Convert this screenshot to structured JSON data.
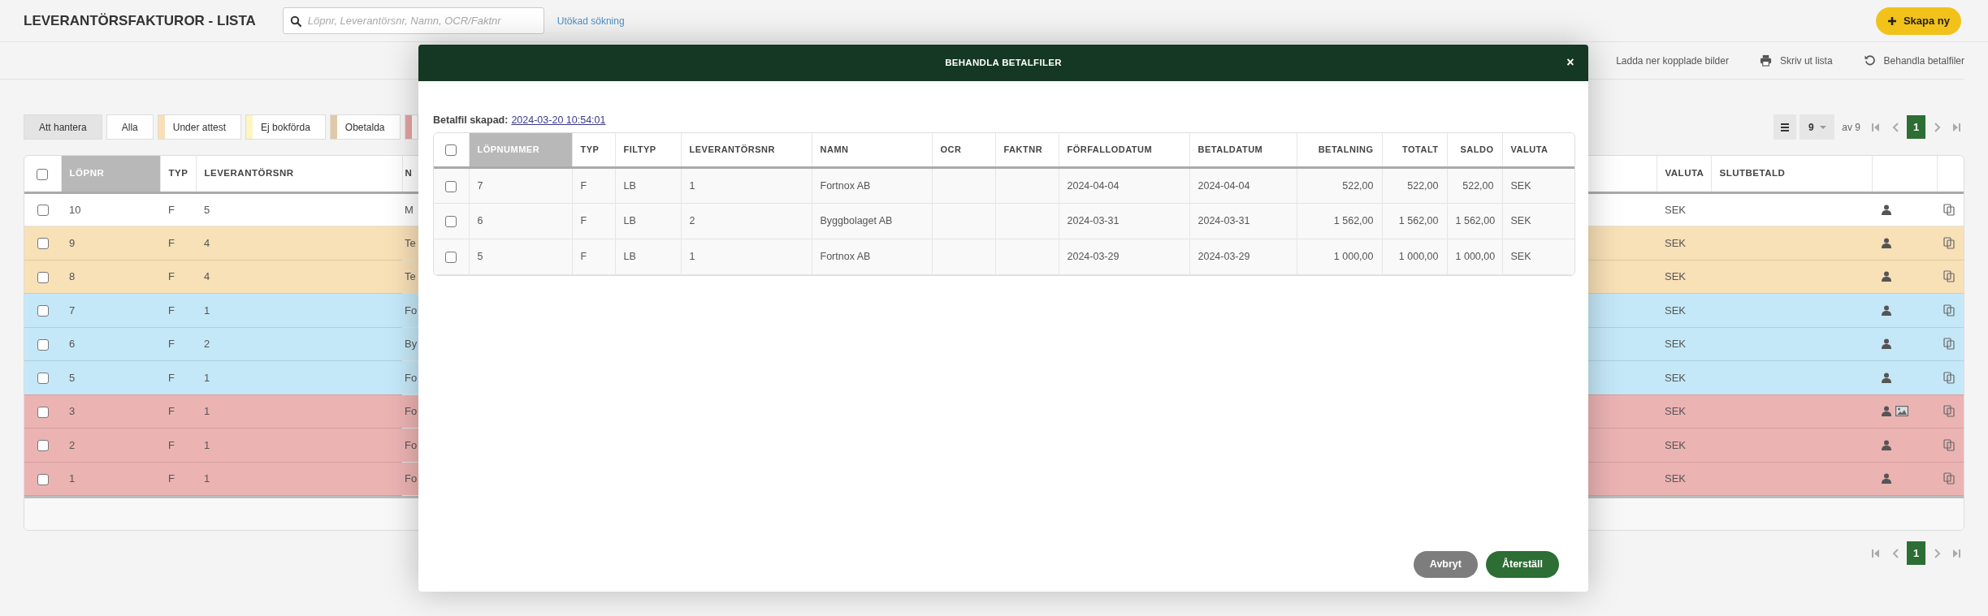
{
  "header": {
    "title": "LEVERANTÖRSFAKTUROR - LISTA",
    "search": {
      "placeholder": "Löpnr, Leverantörsnr, Namn, OCR/Faktnr"
    },
    "advanced_link": "Utökad sökning",
    "create_button": "Skapa ny"
  },
  "actions": [
    {
      "label": "Ladda ner kopplade bilder",
      "kind": "plain"
    },
    {
      "label": "Skriv ut lista",
      "kind": "print"
    },
    {
      "label": "Behandla betalfiler",
      "kind": "undo"
    }
  ],
  "filters": [
    {
      "label": "Att hantera",
      "selected": true
    },
    {
      "label": "Alla",
      "selected": false
    },
    {
      "label": "Under attest",
      "selected": false,
      "color": "#f9dfb5"
    },
    {
      "label": "Ej bokförda",
      "selected": false,
      "color": "#fdf5c2"
    },
    {
      "label": "Obetalda",
      "selected": false,
      "color": "#e2c8a6"
    },
    {
      "selected": false,
      "color": "#e3a3a3"
    }
  ],
  "pagination": {
    "page_size": "9",
    "of_text": "av 9",
    "current_page": "1"
  },
  "table": {
    "header_checked": false,
    "columns": [
      {
        "label": "LÖPNR",
        "sorted": true
      },
      {
        "label": "TYP",
        "sorted": false
      },
      {
        "label": "LEVERANTÖRSNR",
        "sorted": false
      },
      {
        "label": "N",
        "sorted": false
      },
      {
        "label": "VALUTA",
        "sorted": false
      },
      {
        "label": "SLUTBETALD",
        "sorted": false
      }
    ],
    "rows": [
      {
        "checked": false,
        "lopnr": "10",
        "typ": "F",
        "levnr": "5",
        "namn": "M",
        "valuta": "SEK",
        "has_image": false,
        "color": "#ffffff"
      },
      {
        "checked": false,
        "lopnr": "9",
        "typ": "F",
        "levnr": "4",
        "namn": "Te",
        "valuta": "SEK",
        "has_image": false,
        "color": "#f8e0b7"
      },
      {
        "checked": false,
        "lopnr": "8",
        "typ": "F",
        "levnr": "4",
        "namn": "Te",
        "valuta": "SEK",
        "has_image": false,
        "color": "#f8e0b7"
      },
      {
        "checked": false,
        "lopnr": "7",
        "typ": "F",
        "levnr": "1",
        "namn": "Fo",
        "valuta": "SEK",
        "has_image": false,
        "color": "#c5e8f8"
      },
      {
        "checked": false,
        "lopnr": "6",
        "typ": "F",
        "levnr": "2",
        "namn": "By",
        "valuta": "SEK",
        "has_image": false,
        "color": "#c5e8f8"
      },
      {
        "checked": false,
        "lopnr": "5",
        "typ": "F",
        "levnr": "1",
        "namn": "Fo",
        "valuta": "SEK",
        "has_image": false,
        "color": "#c5e8f8"
      },
      {
        "checked": false,
        "lopnr": "3",
        "typ": "F",
        "levnr": "1",
        "namn": "Fo",
        "valuta": "SEK",
        "has_image": true,
        "color": "#ecb3b3"
      },
      {
        "checked": false,
        "lopnr": "2",
        "typ": "F",
        "levnr": "1",
        "namn": "Fo",
        "valuta": "SEK",
        "has_image": false,
        "color": "#ecb3b3"
      },
      {
        "checked": false,
        "lopnr": "1",
        "typ": "F",
        "levnr": "1",
        "namn": "Fo",
        "valuta": "SEK",
        "has_image": false,
        "color": "#ecb3b3"
      }
    ]
  },
  "bottom_pagination": {
    "current_page": "1"
  },
  "modal": {
    "title": "BEHANDLA BETALFILER",
    "close": "×",
    "created_label": "Betalfil skapad:",
    "created_link": "2024-03-20 10:54:01",
    "table": {
      "header_checked": false,
      "columns": [
        {
          "label": "LÖPNUMMER",
          "sorted": true
        },
        {
          "label": "TYP",
          "sorted": false
        },
        {
          "label": "FILTYP",
          "sorted": false
        },
        {
          "label": "LEVERANTÖRSNR",
          "sorted": false
        },
        {
          "label": "NAMN",
          "sorted": false
        },
        {
          "label": "OCR",
          "sorted": false
        },
        {
          "label": "FAKTNR",
          "sorted": false
        },
        {
          "label": "FÖRFALLODATUM",
          "sorted": false
        },
        {
          "label": "BETALDATUM",
          "sorted": false
        },
        {
          "label": "BETALNING",
          "sorted": false
        },
        {
          "label": "TOTALT",
          "sorted": false
        },
        {
          "label": "SALDO",
          "sorted": false
        },
        {
          "label": "VALUTA",
          "sorted": false
        }
      ],
      "rows": [
        {
          "checked": false,
          "lopnummer": "7",
          "typ": "F",
          "filtyp": "LB",
          "leverantorsnr": "1",
          "namn": "Fortnox AB",
          "forfallodatum": "2024-04-04",
          "betaldatum": "2024-04-04",
          "betalning": "522,00",
          "totalt": "522,00",
          "saldo": "522,00",
          "valuta": "SEK"
        },
        {
          "checked": false,
          "lopnummer": "6",
          "typ": "F",
          "filtyp": "LB",
          "leverantorsnr": "2",
          "namn": "Byggbolaget AB",
          "forfallodatum": "2024-03-31",
          "betaldatum": "2024-03-31",
          "betalning": "1 562,00",
          "totalt": "1 562,00",
          "saldo": "1 562,00",
          "valuta": "SEK"
        },
        {
          "checked": false,
          "lopnummer": "5",
          "typ": "F",
          "filtyp": "LB",
          "leverantorsnr": "1",
          "namn": "Fortnox AB",
          "forfallodatum": "2024-03-29",
          "betaldatum": "2024-03-29",
          "betalning": "1 000,00",
          "totalt": "1 000,00",
          "saldo": "1 000,00",
          "valuta": "SEK"
        }
      ]
    },
    "buttons": [
      {
        "label": "Avbryt",
        "kind": "cancel"
      },
      {
        "label": "Återställ",
        "kind": "primary"
      }
    ]
  }
}
